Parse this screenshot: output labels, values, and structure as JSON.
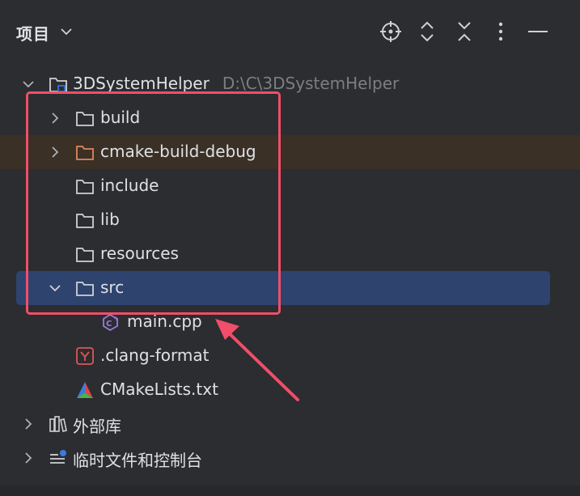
{
  "panel": {
    "title": "项目",
    "toolbar": [
      "locate-icon",
      "expand-all-icon",
      "collapse-all-icon",
      "more-options-icon",
      "minimize-icon"
    ]
  },
  "tree": {
    "root": {
      "name": "3DSystemHelper",
      "path": "D:\\C\\3DSystemHelper"
    },
    "items": [
      {
        "name": "build"
      },
      {
        "name": "cmake-build-debug"
      },
      {
        "name": "include"
      },
      {
        "name": "lib"
      },
      {
        "name": "resources"
      },
      {
        "name": "src"
      },
      {
        "name": "main.cpp"
      },
      {
        "name": ".clang-format"
      },
      {
        "name": "CMakeLists.txt"
      }
    ],
    "external": {
      "name": "外部库"
    },
    "scratches": {
      "name": "临时文件和控制台"
    }
  },
  "colors": {
    "background": "#2b2d30",
    "selection": "#2e436e",
    "excluded_highlight": "#3a3026",
    "annotation": "#f04e6a"
  }
}
